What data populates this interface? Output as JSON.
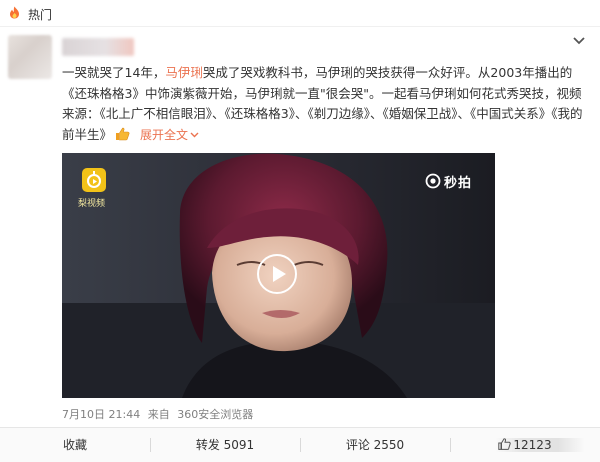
{
  "hot": {
    "label": "热门"
  },
  "post": {
    "text_seg1": "一哭就哭了14年，",
    "name1": "马伊琍",
    "text_seg2": "哭成了哭戏教科书，马伊琍的哭技获得一众好评。从2003年播出的《还珠格格3》中饰演紫薇开始，马伊琍就一直\"很会哭\"。一起看马伊琍如何花式秀哭技，视频来源：《北上广不相信眼泪》、《还珠格格3》、《剃刀边缘》、《婚姻保卫战》、《中国式关系》《我的前半生》",
    "expand": "展开全文"
  },
  "video": {
    "badge_text": "梨视频",
    "brand_text": "秒拍"
  },
  "meta": {
    "time": "7月10日 21:44",
    "from": "来自",
    "source": "360安全浏览器"
  },
  "actions": {
    "favorite": "收藏",
    "repost": "转发 5091",
    "comment": "评论 2550",
    "like": "12123"
  },
  "colors": {
    "accent": "#eb7350",
    "text": "#333333",
    "meta": "#808080"
  }
}
